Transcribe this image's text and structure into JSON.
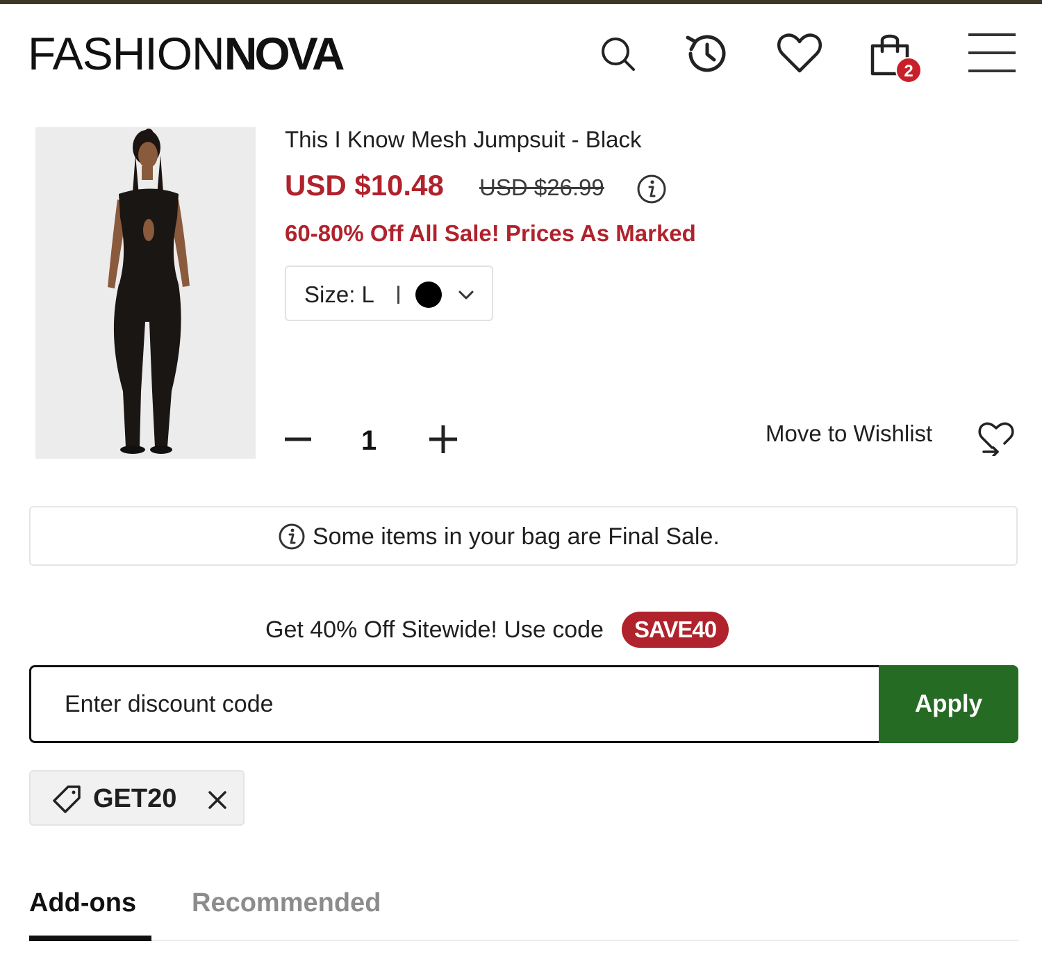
{
  "header": {
    "logo_light": "FASHION",
    "logo_bold": "NOVA",
    "icons": [
      "search-icon",
      "history-icon",
      "heart-icon",
      "bag-icon",
      "menu-icon"
    ],
    "cart_count": "2"
  },
  "cart_item": {
    "title": "This I Know Mesh Jumpsuit - Black",
    "price": "USD $10.48",
    "compare_price": "USD $26.99",
    "promo": "60-80% Off All Sale! Prices As Marked",
    "variant_label": "Size: L",
    "swatch_color": "#000000",
    "quantity": "1",
    "move_to_wishlist": "Move to Wishlist"
  },
  "notice": {
    "text": "Some items in your bag are Final Sale."
  },
  "promo_banner": {
    "text": "Get 40% Off Sitewide! Use code",
    "code": "SAVE40"
  },
  "discount": {
    "placeholder": "Enter discount code",
    "apply_label": "Apply",
    "applied_code": "GET20"
  },
  "tabs": [
    {
      "label": "Add-ons",
      "active": true
    },
    {
      "label": "Recommended",
      "active": false
    }
  ],
  "colors": {
    "sale_red": "#b0222c",
    "badge_red": "#c8202a",
    "apply_green": "#266b23",
    "top_bar": "#3b3826"
  }
}
